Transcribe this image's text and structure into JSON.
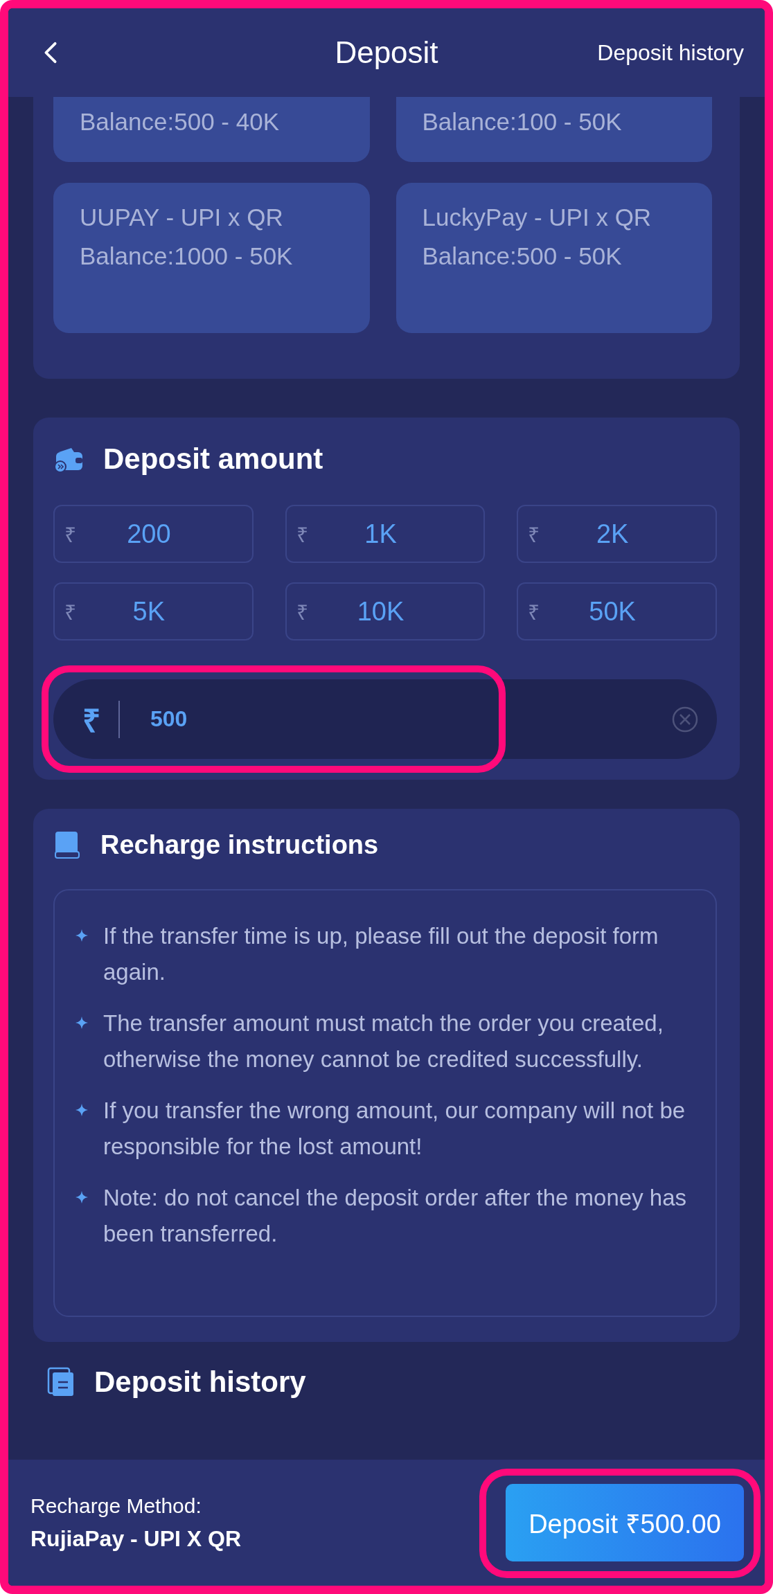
{
  "frame_highlighted": true,
  "header": {
    "title": "Deposit",
    "history_link": "Deposit history"
  },
  "channels": [
    {
      "balance": "Balance:500 - 40K"
    },
    {
      "balance": "Balance:100 - 50K"
    },
    {
      "name": "UUPAY - UPI x QR",
      "balance": "Balance:1000 - 50K"
    },
    {
      "name": "LuckyPay - UPI x QR",
      "balance": "Balance:500 - 50K"
    }
  ],
  "amount": {
    "title": "Deposit amount",
    "presets": [
      {
        "currency": "₹",
        "value": "200"
      },
      {
        "currency": "₹",
        "value": "1K"
      },
      {
        "currency": "₹",
        "value": "2K"
      },
      {
        "currency": "₹",
        "value": "5K"
      },
      {
        "currency": "₹",
        "value": "10K"
      },
      {
        "currency": "₹",
        "value": "50K"
      }
    ],
    "field": {
      "currency": "₹",
      "value": "500",
      "highlighted": true
    }
  },
  "instructions": {
    "title": "Recharge instructions",
    "items": [
      "If the transfer time is up, please fill out the deposit form again.",
      "The transfer amount must match the order you created, otherwise the money cannot be credited successfully.",
      "If you transfer the wrong amount, our company will not be responsible for the lost amount!",
      "Note: do not cancel the deposit order after the money has been transferred."
    ]
  },
  "history": {
    "title": "Deposit history"
  },
  "footer": {
    "method_label": "Recharge Method:",
    "method_value": "RujiaPay - UPI X QR",
    "button": {
      "label": "Deposit ₹500.00",
      "highlighted": true
    }
  }
}
